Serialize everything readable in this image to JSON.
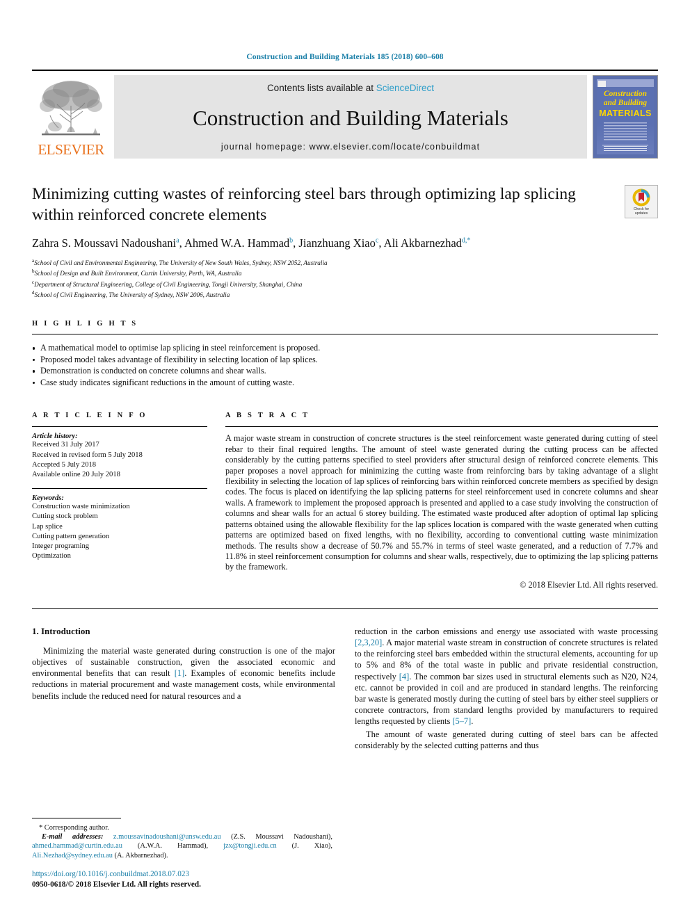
{
  "running_head": "Construction and Building Materials 185 (2018) 600–608",
  "masthead": {
    "publisher_name": "ELSEVIER",
    "contents_prefix": "Contents lists available at ",
    "contents_link": "ScienceDirect",
    "journal_title": "Construction and Building Materials",
    "homepage": "journal homepage: www.elsevier.com/locate/conbuildmat",
    "cover": {
      "line1": "Construction",
      "line2": "and Building",
      "line3": "MATERIALS"
    }
  },
  "article": {
    "title": "Minimizing cutting wastes of reinforcing steel bars through optimizing lap splicing within reinforced concrete elements",
    "crossmark_label_1": "Check for",
    "crossmark_label_2": "updates",
    "authors": [
      {
        "name": "Zahra S. Moussavi Nadoushani",
        "sup": "a"
      },
      {
        "name": "Ahmed W.A. Hammad",
        "sup": "b"
      },
      {
        "name": "Jianzhuang Xiao",
        "sup": "c"
      },
      {
        "name": "Ali Akbarnezhad",
        "sup": "d,*"
      }
    ],
    "affiliations": [
      {
        "marker": "a",
        "text": "School of Civil and Environmental Engineering, The University of New South Wales, Sydney, NSW 2052, Australia"
      },
      {
        "marker": "b",
        "text": "School of Design and Built Environment, Curtin University, Perth, WA, Australia"
      },
      {
        "marker": "c",
        "text": "Department of Structural Engineering, College of Civil Engineering, Tongji University, Shanghai, China"
      },
      {
        "marker": "d",
        "text": "School of Civil Engineering, The University of Sydney, NSW 2006, Australia"
      }
    ]
  },
  "highlights": {
    "heading": "H I G H L I G H T S",
    "items": [
      "A mathematical model to optimise lap splicing in steel reinforcement is proposed.",
      "Proposed model takes advantage of flexibility in selecting location of lap splices.",
      "Demonstration is conducted on concrete columns and shear walls.",
      "Case study indicates significant reductions in the amount of cutting waste."
    ]
  },
  "article_info": {
    "heading": "A R T I C L E    I N F O",
    "history_label": "Article history:",
    "history": [
      "Received 31 July 2017",
      "Received in revised form 5 July 2018",
      "Accepted 5 July 2018",
      "Available online 20 July 2018"
    ],
    "keywords_label": "Keywords:",
    "keywords": [
      "Construction waste minimization",
      "Cutting stock problem",
      "Lap splice",
      "Cutting pattern generation",
      "Integer programing",
      "Optimization"
    ]
  },
  "abstract": {
    "heading": "A B S T R A C T",
    "text": "A major waste stream in construction of concrete structures is the steel reinforcement waste generated during cutting of steel rebar to their final required lengths. The amount of steel waste generated during the cutting process can be affected considerably by the cutting patterns specified to steel providers after structural design of reinforced concrete elements. This paper proposes a novel approach for minimizing the cutting waste from reinforcing bars by taking advantage of a slight flexibility in selecting the location of lap splices of reinforcing bars within reinforced concrete members as specified by design codes. The focus is placed on identifying the lap splicing patterns for steel reinforcement used in concrete columns and shear walls. A framework to implement the proposed approach is presented and applied to a case study involving the construction of columns and shear walls for an actual 6 storey building. The estimated waste produced after adoption of optimal lap splicing patterns obtained using the allowable flexibility for the lap splices location is compared with the waste generated when cutting patterns are optimized based on fixed lengths, with no flexibility, according to conventional cutting waste minimization methods. The results show a decrease of 50.7% and 55.7% in terms of steel waste generated, and a reduction of 7.7% and 11.8% in steel reinforcement consumption for columns and shear walls, respectively, due to optimizing the lap splicing patterns by the framework.",
    "copyright": "© 2018 Elsevier Ltd. All rights reserved."
  },
  "body": {
    "section_title": "1. Introduction",
    "left_para_1_a": "Minimizing the material waste generated during construction is one of the major objectives of sustainable construction, given the associated economic and environmental benefits that can result ",
    "left_ref_1": "[1]",
    "left_para_1_b": ". Examples of economic benefits include reductions in material procurement and waste management costs, while environmental benefits include the reduced need for natural resources and a",
    "right_para_1_a": "reduction in the carbon emissions and energy use associated with waste processing ",
    "right_ref_1": "[2,3,20]",
    "right_para_1_b": ". A major material waste stream in construction of concrete structures is related to the reinforcing steel bars embedded within the structural elements, accounting for up to 5% and 8% of the total waste in public and private residential construction, respectively ",
    "right_ref_2": "[4]",
    "right_para_1_c": ". The common bar sizes used in structural elements such as N20, N24, etc. cannot be provided in coil and are produced in standard lengths. The reinforcing bar waste is generated mostly during the cutting of steel bars by either steel suppliers or concrete contractors, from standard lengths provided by manufacturers to required lengths requested by clients ",
    "right_ref_3": "[5–7]",
    "right_para_1_d": ".",
    "right_para_2": "The amount of waste generated during cutting of steel bars can be affected considerably by the selected cutting patterns and thus"
  },
  "footnote": {
    "corresponding": "* Corresponding author.",
    "email_label": "E-mail addresses:",
    "email_1": "z.moussavinadoushani@unsw.edu.au",
    "email_1_owner": " (Z.S. Moussavi Nadoushani), ",
    "email_2": "ahmed.hammad@curtin.edu.au",
    "email_2_owner": " (A.W.A. Hammad), ",
    "email_3": "jzx@tongji.edu.cn",
    "email_3_owner": " (J. Xiao), ",
    "email_4": "Ali.Nezhad@sydney.edu.au",
    "email_4_owner": " (A. Akbarnezhad).",
    "doi": "https://doi.org/10.1016/j.conbuildmat.2018.07.023",
    "issn": "0950-0618/© 2018 Elsevier Ltd. All rights reserved."
  },
  "colors": {
    "link_blue": "#1a7fa8",
    "sciencedirect_blue": "#2e9ec9",
    "elsevier_orange": "#E9711C",
    "cover_blue": "#5b70b2",
    "cover_yellow": "#ffd700"
  }
}
